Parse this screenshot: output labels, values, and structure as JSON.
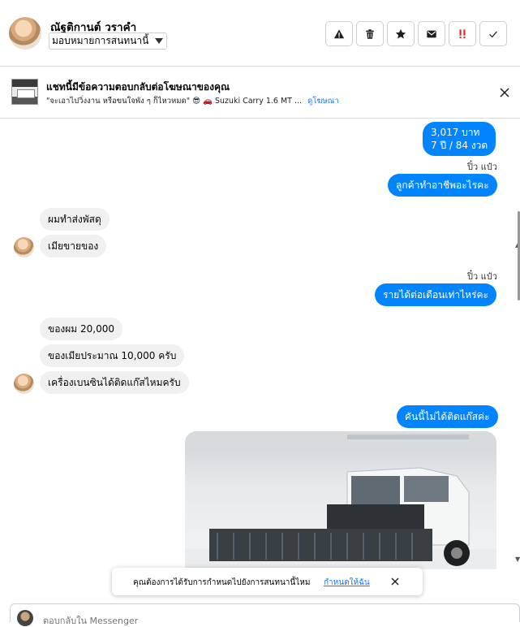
{
  "header": {
    "contact_name": "ณัฐติกานต์ วราคำ",
    "assign_label": "มอบหมายการสนทนานี้",
    "actions": [
      {
        "name": "report-spam-button",
        "icon": "warning-icon"
      },
      {
        "name": "delete-button",
        "icon": "trash-icon"
      },
      {
        "name": "star-button",
        "icon": "star-icon"
      },
      {
        "name": "mark-unread-button",
        "icon": "envelope-icon"
      },
      {
        "name": "follow-up-button",
        "icon": "double-exclamation-icon"
      },
      {
        "name": "mark-done-button",
        "icon": "check-icon"
      }
    ]
  },
  "banner": {
    "title": "แชทนี้มีข้อความตอบกลับต่อโฆษณาของคุณ",
    "subtitle": "\"จะเอาไปวิ่งงาน หรือขนใจพัง ๆ ก็ไหวหมด\" 😎 🚗 Suzuki Carry 1.6 MT ...",
    "link": "ดูโฆษณา"
  },
  "messages": {
    "m1_line1": "3,017 บาท",
    "m1_line2": "7 ปี / 84 งวด",
    "sender1": "ปิ๋ว แป๋ว",
    "m2": "ลูกค้าทำอาชีพอะไรคะ",
    "m3": "ผมทำส่งพัสดุ",
    "m4": "เมียขายของ",
    "sender2": "ปิ๋ว แป๋ว",
    "m5": "รายได้ต่อเดือนเท่าไหร่คะ",
    "m6": "ของผม 20,000",
    "m7": "ของเมียประมาณ 10,000 ครับ",
    "m8": "เครื่องเบนซินได้ติดแก๊สไหมครับ",
    "m9": "คันนี้ไม่ได้ติดแก๊สค่ะ"
  },
  "toast": {
    "text": "คุณต้องการได้รับการกำหนดไปยังการสนทนานี้ไหม",
    "link": "กำหนดให้ฉัน"
  },
  "composer": {
    "placeholder": "ตอบกลับใน Messenger"
  },
  "colors": {
    "accent": "#0084ff",
    "incoming_bubble": "#f0f0f0"
  }
}
